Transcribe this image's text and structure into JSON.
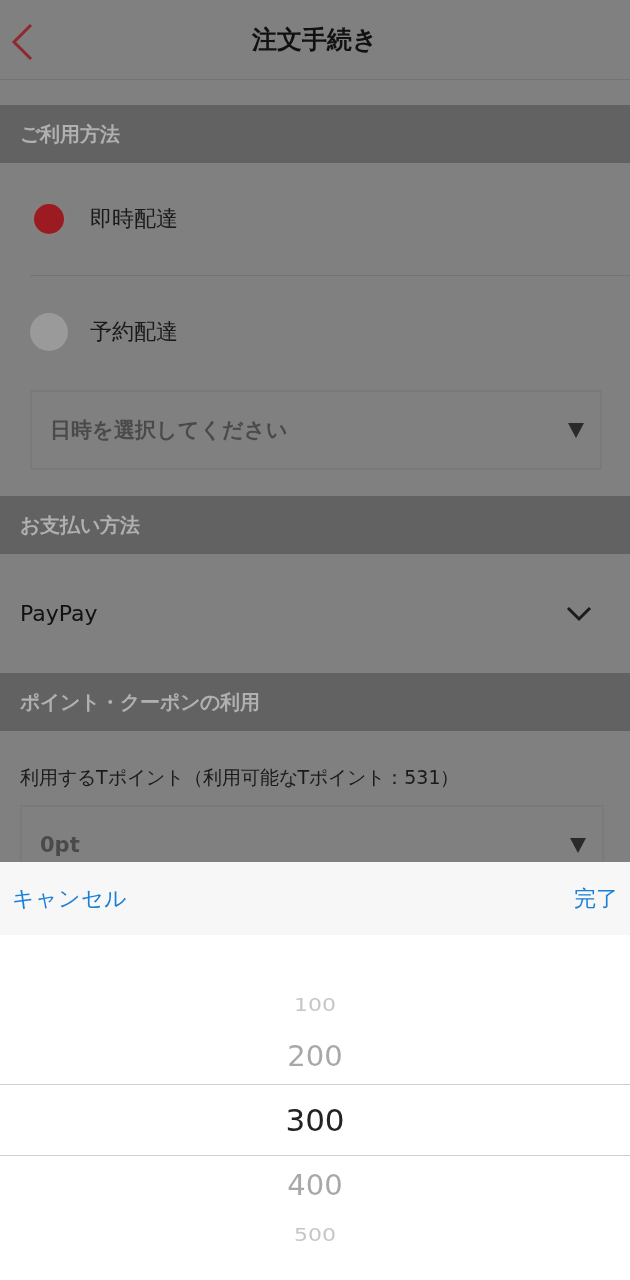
{
  "nav": {
    "title": "注文手続き"
  },
  "usage": {
    "heading": "ご利用方法",
    "options": [
      {
        "label": "即時配達",
        "selected": true
      },
      {
        "label": "予約配達",
        "selected": false
      }
    ],
    "datetime_select": {
      "placeholder": "日時を選択してください"
    }
  },
  "payment": {
    "heading": "お支払い方法",
    "method": "PayPay"
  },
  "points": {
    "heading": "ポイント・クーポンの利用",
    "label": "利用するTポイント（利用可能なTポイント：531）",
    "select_value": "0pt"
  },
  "picker": {
    "cancel": "キャンセル",
    "done": "完了",
    "items": [
      {
        "label": "100",
        "selected": false
      },
      {
        "label": "200",
        "selected": false
      },
      {
        "label": "300",
        "selected": true
      },
      {
        "label": "400",
        "selected": false
      },
      {
        "label": "500",
        "selected": false
      }
    ]
  }
}
